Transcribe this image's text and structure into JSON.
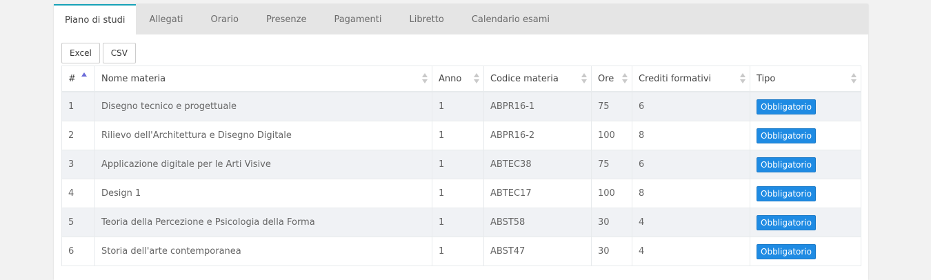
{
  "tabs": [
    {
      "label": "Piano di studi",
      "active": true
    },
    {
      "label": "Allegati",
      "active": false
    },
    {
      "label": "Orario",
      "active": false
    },
    {
      "label": "Presenze",
      "active": false
    },
    {
      "label": "Pagamenti",
      "active": false
    },
    {
      "label": "Libretto",
      "active": false
    },
    {
      "label": "Calendario esami",
      "active": false
    }
  ],
  "toolbar": {
    "excel_label": "Excel",
    "csv_label": "CSV"
  },
  "table": {
    "columns": [
      "#",
      "Nome materia",
      "Anno",
      "Codice materia",
      "Ore",
      "Crediti formativi",
      "Tipo"
    ],
    "rows": [
      {
        "n": "1",
        "nome": "Disegno tecnico e progettuale",
        "anno": "1",
        "codice": "ABPR16-1",
        "ore": "75",
        "crediti": "6",
        "tipo": "Obbligatorio"
      },
      {
        "n": "2",
        "nome": "Rilievo dell'Architettura e Disegno Digitale",
        "anno": "1",
        "codice": "ABPR16-2",
        "ore": "100",
        "crediti": "8",
        "tipo": "Obbligatorio"
      },
      {
        "n": "3",
        "nome": "Applicazione digitale per le Arti Visive",
        "anno": "1",
        "codice": "ABTEC38",
        "ore": "75",
        "crediti": "6",
        "tipo": "Obbligatorio"
      },
      {
        "n": "4",
        "nome": "Design 1",
        "anno": "1",
        "codice": "ABTEC17",
        "ore": "100",
        "crediti": "8",
        "tipo": "Obbligatorio"
      },
      {
        "n": "5",
        "nome": "Teoria della Percezione e Psicologia della Forma",
        "anno": "1",
        "codice": "ABST58",
        "ore": "30",
        "crediti": "4",
        "tipo": "Obbligatorio"
      },
      {
        "n": "6",
        "nome": "Storia dell'arte contemporanea",
        "anno": "1",
        "codice": "ABST47",
        "ore": "30",
        "crediti": "4",
        "tipo": "Obbligatorio"
      }
    ]
  },
  "colors": {
    "accent": "#17a2b8",
    "badge": "#1f8be3",
    "sort_active": "#6a6ad8"
  }
}
